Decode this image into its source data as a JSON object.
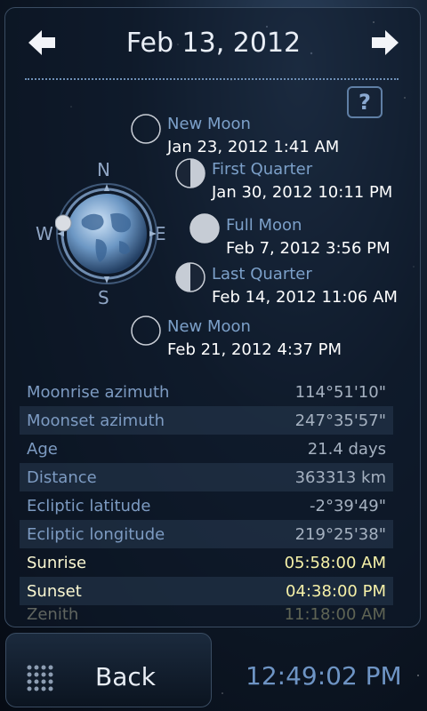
{
  "header": {
    "date": "Feb 13, 2012",
    "prev_icon": "arrow-left-icon",
    "next_icon": "arrow-right-icon",
    "help_label": "?"
  },
  "compass": {
    "north": "N",
    "south": "S",
    "east": "E",
    "west": "W"
  },
  "phases": [
    {
      "name": "New Moon",
      "date": "Jan 23, 2012 1:41 AM",
      "icon": "new-moon-icon"
    },
    {
      "name": "First Quarter",
      "date": "Jan 30, 2012 10:11 PM",
      "icon": "first-quarter-icon"
    },
    {
      "name": "Full Moon",
      "date": "Feb 7, 2012 3:56 PM",
      "icon": "full-moon-icon"
    },
    {
      "name": "Last Quarter",
      "date": "Feb 14, 2012 11:06 AM",
      "icon": "last-quarter-icon"
    },
    {
      "name": "New Moon",
      "date": "Feb 21, 2012 4:37 PM",
      "icon": "new-moon-icon"
    }
  ],
  "details": [
    {
      "label": "Moonrise azimuth",
      "value": "114°51'10\""
    },
    {
      "label": "Moonset azimuth",
      "value": "247°35'57\""
    },
    {
      "label": "Age",
      "value": "21.4 days"
    },
    {
      "label": "Distance",
      "value": "363313 km"
    },
    {
      "label": "Ecliptic latitude",
      "value": "-2°39'49\""
    },
    {
      "label": "Ecliptic longitude",
      "value": "219°25'38\""
    },
    {
      "label": "Sunrise",
      "value": "05:58:00 AM"
    },
    {
      "label": "Sunset",
      "value": "04:38:00 PM"
    },
    {
      "label": "Zenith",
      "value": "11:18:00 AM"
    }
  ],
  "footer": {
    "back_label": "Back",
    "clock": "12:49:02 PM"
  },
  "colors": {
    "accent": "#7ca0c9",
    "sun_text": "#f6f1a8",
    "value_text": "#a5b1c0"
  }
}
